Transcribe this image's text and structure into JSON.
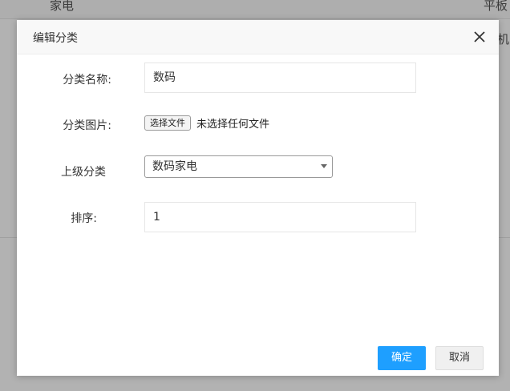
{
  "background": {
    "cells": [
      "家电",
      "平板",
      "机"
    ]
  },
  "dialog": {
    "title": "编辑分类",
    "close_icon": "close-icon"
  },
  "form": {
    "name_label": "分类名称:",
    "name_value": "数码",
    "image_label": "分类图片:",
    "file_button_label": "选择文件",
    "file_status": "未选择任何文件",
    "parent_label": "上级分类",
    "parent_value": "数码家电",
    "order_label": "排序:",
    "order_value": "1"
  },
  "buttons": {
    "confirm": "确定",
    "cancel": "取消"
  },
  "colors": {
    "primary": "#1e9fff",
    "overlay": "rgba(0,0,0,0.3)"
  }
}
